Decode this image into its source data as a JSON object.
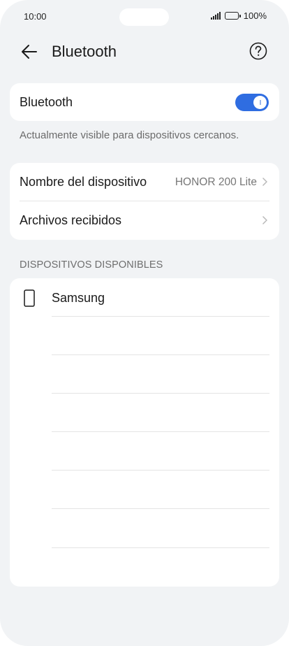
{
  "status_bar": {
    "time": "10:00",
    "battery": "100%"
  },
  "header": {
    "title": "Bluetooth",
    "back_icon": "arrow-left-icon",
    "help_icon": "question-circle-icon"
  },
  "bluetooth_card": {
    "label": "Bluetooth",
    "toggle_on": true,
    "accent_color": "#2f6de1"
  },
  "visibility_text": "Actualmente visible para dispositivos cercanos.",
  "device_card": {
    "rows": [
      {
        "label": "Nombre del dispositivo",
        "value": "HONOR 200 Lite"
      },
      {
        "label": "Archivos recibidos",
        "value": ""
      }
    ]
  },
  "available": {
    "section_title": "DISPOSITIVOS DISPONIBLES",
    "devices": [
      {
        "name": "Samsung",
        "icon": "phone-icon"
      }
    ]
  }
}
